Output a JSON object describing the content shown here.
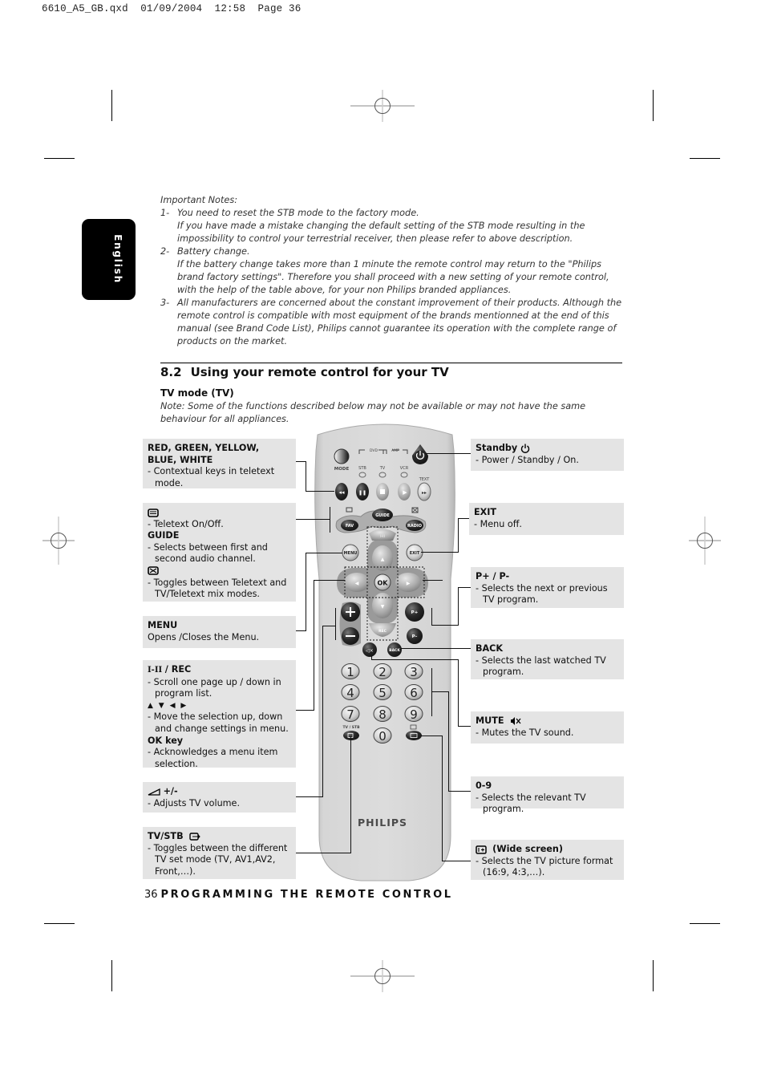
{
  "slug": "6610_A5_GB.qxd  01/09/2004  12:58  Page 36",
  "language_tab": "English",
  "notes": {
    "title": "Important Notes:",
    "items": [
      {
        "num": "1-",
        "lines": [
          "You need to reset the STB mode to the factory mode.",
          "If you have made a mistake changing the default setting of the STB mode resulting in the impossibility to control your terrestrial  receiver, then please refer to above description."
        ]
      },
      {
        "num": "2-",
        "lines": [
          "Battery change.",
          "If the battery change takes more than 1 minute the remote control may return to the \"Philips brand factory settings\". Therefore you shall proceed with a new setting of your remote control, with the help of the table above, for your non Philips branded appliances."
        ]
      },
      {
        "num": "3-",
        "lines": [
          "All manufacturers are concerned about the constant improvement of their products. Although the remote control is compatible with most equipment of the brands mentionned at the end of this manual (see Brand Code List), Philips cannot guarantee its operation with the complete range of products on the market."
        ]
      }
    ]
  },
  "section": {
    "number": "8.2",
    "title": "Using your remote control for your TV"
  },
  "subheading": "TV mode (TV)",
  "note": "Note: Some of the functions described below may not be available or may not have the same behaviour for all appliances.",
  "left_boxes": {
    "colors": {
      "title": "RED, GREEN, YELLOW, BLUE, WHITE",
      "desc": "- Contextual keys in teletext mode."
    },
    "teletext": {
      "desc1": "- Teletext On/Off.",
      "title2": "GUIDE",
      "desc2": "- Selects between first and second audio channel.",
      "desc3": "- Toggles between Teletext and TV/Teletext mix modes."
    },
    "menu": {
      "title": "MENU",
      "desc": "Opens /Closes the Menu."
    },
    "nav": {
      "title": "/ REC",
      "icon_label": "I-II",
      "desc1": "- Scroll one page up / down in program list.",
      "arrows": "▲ ▼ ◀ ▶",
      "desc2": "- Move the selection up, down and change settings in menu.",
      "title3": "OK key",
      "desc3": "- Acknowledges a menu item selection."
    },
    "volume": {
      "title": "+/-",
      "desc": "- Adjusts TV volume."
    },
    "tvstb": {
      "title": "TV/STB",
      "desc": "- Toggles between the different TV set mode (TV, AV1,AV2, Front,…)."
    }
  },
  "right_boxes": {
    "standby": {
      "title": "Standby",
      "desc": "- Power / Standby / On."
    },
    "exit": {
      "title": "EXIT",
      "desc": "- Menu off."
    },
    "program": {
      "title": "P+ / P-",
      "desc": "- Selects the next or previous TV program."
    },
    "back": {
      "title": "BACK",
      "desc": "- Selects the last watched TV program."
    },
    "mute": {
      "title": "MUTE",
      "desc": "- Mutes the TV sound."
    },
    "digits": {
      "title": "0-9",
      "desc": "- Selects the relevant TV program."
    },
    "wide": {
      "title": "(Wide screen)",
      "desc": "- Selects the TV picture format (16:9, 4:3,…)."
    }
  },
  "remote": {
    "brand": "PHILIPS",
    "mode_label": "MODE",
    "device_labels": [
      "STB",
      "TV",
      "VCR"
    ],
    "group_labels": [
      "DVD",
      "AMP"
    ],
    "text_label": "TEXT",
    "guide": "GUIDE",
    "fav": "FAV",
    "radio": "RADIO",
    "menu": "MENU",
    "exit": "EXIT",
    "ok": "OK",
    "rec": "REC",
    "back": "BACK",
    "p_plus": "P+",
    "p_minus": "P–",
    "tvstb_label": "TV / STB",
    "digits": [
      "1",
      "2",
      "3",
      "4",
      "5",
      "6",
      "7",
      "8",
      "9",
      "0"
    ]
  },
  "footer": {
    "page": "36",
    "title": "PROGRAMMING THE REMOTE CONTROL"
  }
}
